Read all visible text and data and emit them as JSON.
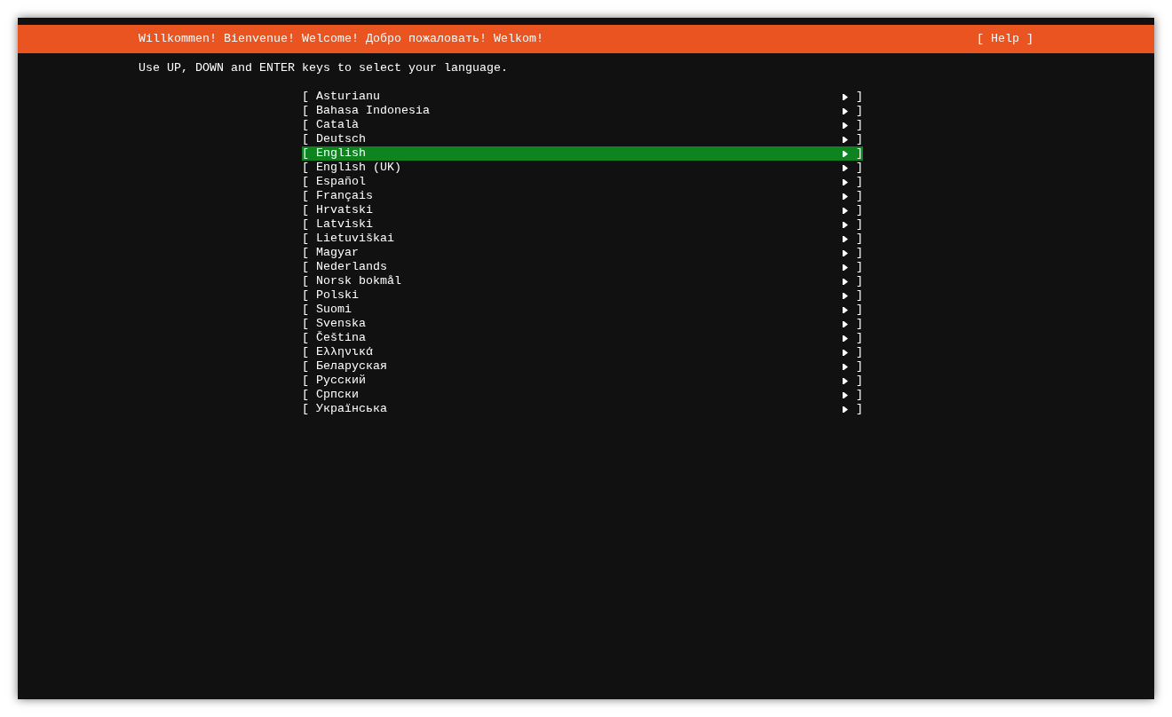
{
  "header": {
    "title": "Willkommen! Bienvenue! Welcome! Добро пожаловать! Welkom!",
    "help_button": "[ Help ]"
  },
  "instruction": "Use UP, DOWN and ENTER keys to select your language.",
  "languages": [
    {
      "open": "[",
      "label": "Asturianu",
      "close": "]",
      "selected": false
    },
    {
      "open": "[",
      "label": "Bahasa Indonesia",
      "close": "]",
      "selected": false
    },
    {
      "open": "[",
      "label": "Català",
      "close": "]",
      "selected": false
    },
    {
      "open": "[",
      "label": "Deutsch",
      "close": "]",
      "selected": false
    },
    {
      "open": "[",
      "label": "English",
      "close": "]",
      "selected": true
    },
    {
      "open": "[",
      "label": "English (UK)",
      "close": "]",
      "selected": false
    },
    {
      "open": "[",
      "label": "Español",
      "close": "]",
      "selected": false
    },
    {
      "open": "[",
      "label": "Français",
      "close": "]",
      "selected": false
    },
    {
      "open": "[",
      "label": "Hrvatski",
      "close": "]",
      "selected": false
    },
    {
      "open": "[",
      "label": "Latviski",
      "close": "]",
      "selected": false
    },
    {
      "open": "[",
      "label": "Lietuviškai",
      "close": "]",
      "selected": false
    },
    {
      "open": "[",
      "label": "Magyar",
      "close": "]",
      "selected": false
    },
    {
      "open": "[",
      "label": "Nederlands",
      "close": "]",
      "selected": false
    },
    {
      "open": "[",
      "label": "Norsk bokmål",
      "close": "]",
      "selected": false
    },
    {
      "open": "[",
      "label": "Polski",
      "close": "]",
      "selected": false
    },
    {
      "open": "[",
      "label": "Suomi",
      "close": "]",
      "selected": false
    },
    {
      "open": "[",
      "label": "Svenska",
      "close": "]",
      "selected": false
    },
    {
      "open": "[",
      "label": "Čeština",
      "close": "]",
      "selected": false
    },
    {
      "open": "[",
      "label": "Ελληνικά",
      "close": "]",
      "selected": false
    },
    {
      "open": "[",
      "label": "Беларуская",
      "close": "]",
      "selected": false
    },
    {
      "open": "[",
      "label": "Русский",
      "close": "]",
      "selected": false
    },
    {
      "open": "[",
      "label": "Српски",
      "close": "]",
      "selected": false
    },
    {
      "open": "[",
      "label": "Українська",
      "close": "]",
      "selected": false
    }
  ]
}
